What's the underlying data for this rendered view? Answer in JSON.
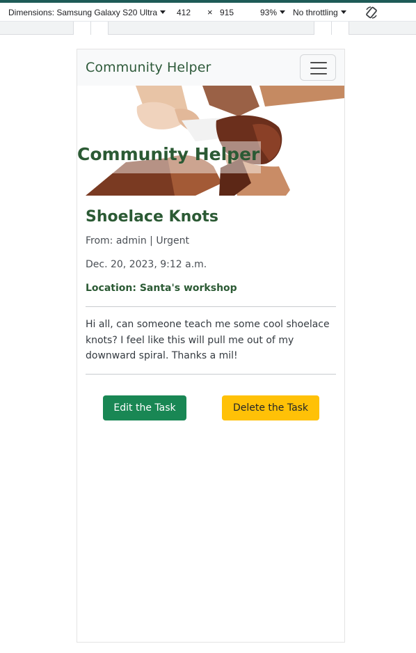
{
  "devtools": {
    "dimensions_label": "Dimensions: Samsung Galaxy S20 Ultra",
    "width": "412",
    "times": "×",
    "height": "915",
    "zoom": "93%",
    "throttling": "No throttling",
    "rotate_icon": "rotate-icon"
  },
  "navbar": {
    "brand": "Community Helper",
    "toggler_icon": "hamburger-menu-icon"
  },
  "hero": {
    "image": "hands-holding-wrists-image",
    "title": "Community Helper"
  },
  "task": {
    "title": "Shoelace Knots",
    "meta": "From: admin | Urgent",
    "date": "Dec. 20, 2023, 9:12 a.m.",
    "location": "Location: Santa's workshop",
    "description": "Hi all, can someone teach me some cool shoelace knots? I feel like this will pull me out of my downward spiral. Thanks a mil!"
  },
  "actions": {
    "edit_label": "Edit the Task",
    "delete_label": "Delete the Task"
  },
  "colors": {
    "brand_green": "#2b5a34",
    "success": "#198754",
    "warning": "#ffc107"
  }
}
